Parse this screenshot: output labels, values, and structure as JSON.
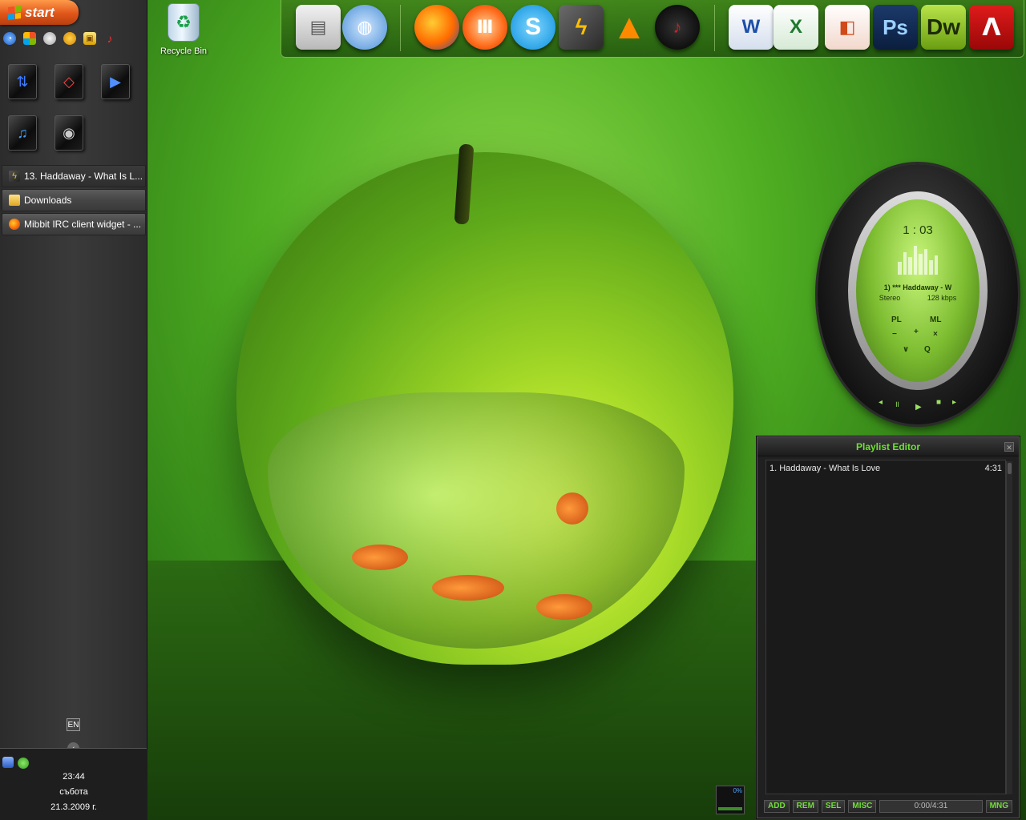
{
  "taskbar": {
    "start_label": "start",
    "tasks": [
      {
        "label": "13. Haddaway - What Is L...",
        "icon": "winamp-icon"
      },
      {
        "label": "Downloads",
        "icon": "folder-icon"
      },
      {
        "label": "Mibbit IRC client widget - ...",
        "icon": "firefox-icon"
      }
    ],
    "language": "EN",
    "clock": {
      "time": "23:44",
      "day": "събота",
      "date": "21.3.2009 г."
    }
  },
  "desktop": {
    "recycle_bin_label": "Recycle Bin"
  },
  "dock": {
    "icons": [
      "computer-icon",
      "network-icon",
      "firefox-icon",
      "opera-icon",
      "skype-icon",
      "winamp-icon",
      "vlc-icon",
      "record-icon",
      "word-icon",
      "excel-icon",
      "powerpoint-icon",
      "photoshop-icon",
      "dreamweaver-icon",
      "acrobat-icon"
    ],
    "ps_label": "Ps",
    "dw_label": "Dw",
    "word_label": "W",
    "excel_label": "X"
  },
  "player": {
    "time": "1 : 03",
    "track_title": "1) *** Haddaway - W",
    "mode": "Stereo",
    "bitrate": "128 kbps",
    "pl_label": "PL",
    "ml_label": "ML"
  },
  "playlist": {
    "title": "Playlist Editor",
    "items": [
      {
        "label": "1. Haddaway - What Is Love",
        "duration": "4:31"
      }
    ],
    "buttons": {
      "add": "ADD",
      "rem": "REM",
      "sel": "SEL",
      "misc": "MISC",
      "mng": "MNG"
    },
    "time_display": "0:00/4:31"
  },
  "colors": {
    "accent_green": "#6fe035",
    "start_orange": "#e0561a"
  }
}
